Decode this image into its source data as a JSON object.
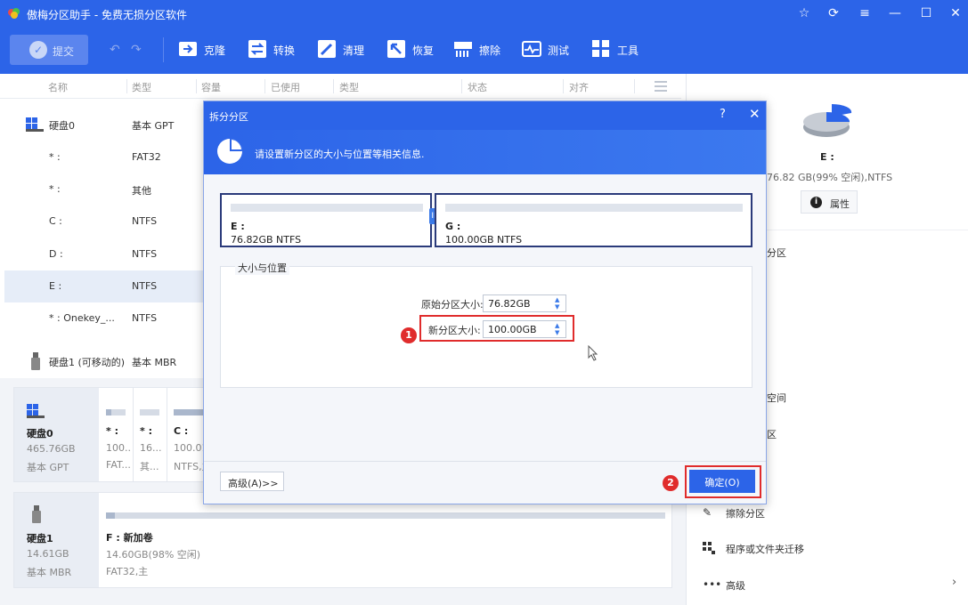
{
  "app": {
    "title": "傲梅分区助手 - 免费无损分区软件"
  },
  "toolbar": {
    "commit_label": "提交",
    "items": [
      {
        "label": "克隆",
        "icon": "clone-icon"
      },
      {
        "label": "转换",
        "icon": "convert-icon"
      },
      {
        "label": "清理",
        "icon": "clean-icon"
      },
      {
        "label": "恢复",
        "icon": "recover-icon"
      },
      {
        "label": "擦除",
        "icon": "wipe-icon"
      },
      {
        "label": "测试",
        "icon": "test-icon"
      },
      {
        "label": "工具",
        "icon": "tools-icon"
      }
    ]
  },
  "columns": [
    "名称",
    "类型",
    "容量",
    "已使用",
    "类型",
    "状态",
    "对齐"
  ],
  "disks": {
    "disk0": {
      "name": "硬盘0",
      "type": "基本 GPT"
    },
    "disk0_partitions": [
      {
        "name": "* :",
        "type": "FAT32"
      },
      {
        "name": "* :",
        "type": "其他"
      },
      {
        "name": "C :",
        "type": "NTFS"
      },
      {
        "name": "D :",
        "type": "NTFS"
      },
      {
        "name": "E :",
        "type": "NTFS"
      },
      {
        "name": "* : Onekey_...",
        "type": "NTFS"
      }
    ],
    "disk1": {
      "name": "硬盘1 (可移动的)",
      "type": "基本 MBR"
    }
  },
  "map": {
    "disk0": {
      "name": "硬盘0",
      "size": "465.76GB",
      "type": "基本 GPT"
    },
    "disk0_parts": [
      {
        "label": "* :",
        "size": "100...",
        "fs": "FAT..."
      },
      {
        "label": "* :",
        "size": "16...",
        "fs": "其..."
      },
      {
        "label": "C :",
        "size": "100.01",
        "fs": "NTFS,主"
      }
    ],
    "disk1": {
      "name": "硬盘1",
      "size": "14.61GB",
      "type": "基本 MBR"
    },
    "disk1_part": {
      "label": "F : 新加卷",
      "size": "14.60GB(98% 空闲)",
      "fs": "FAT32,主"
    }
  },
  "rightpanel": {
    "drive": "E :",
    "info": "76.82 GB(99% 空闲),NTFS",
    "properties_label": "属性",
    "partials": [
      "分区",
      "空间",
      "区"
    ],
    "items": [
      {
        "label": "擦除分区",
        "icon": "wipe-partition-icon"
      },
      {
        "label": "程序或文件夹迁移",
        "icon": "migrate-icon"
      },
      {
        "label": "高级",
        "icon": "more-icon"
      }
    ]
  },
  "dialog": {
    "title": "拆分分区",
    "help": "?",
    "banner_text": "请设置新分区的大小与位置等相关信息.",
    "part_left": {
      "name": "E :",
      "size": "76.82GB NTFS"
    },
    "part_right": {
      "name": "G :",
      "size": "100.00GB NTFS"
    },
    "section_label": "大小与位置",
    "orig_label": "原始分区大小:",
    "orig_value": "76.82GB",
    "new_label": "新分区大小:",
    "new_value": "100.00GB",
    "advanced_label": "高级(A)>>",
    "ok_label": "确定(O)",
    "badge1": "1",
    "badge2": "2"
  }
}
